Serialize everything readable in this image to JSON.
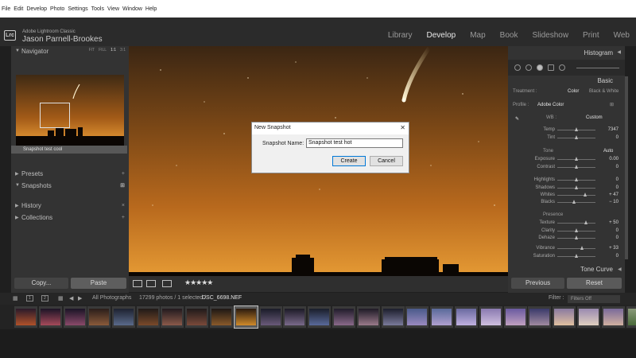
{
  "os_menu": [
    "File",
    "Edit",
    "Develop",
    "Photo",
    "Settings",
    "Tools",
    "View",
    "Window",
    "Help"
  ],
  "identity": {
    "logo": "Lrc",
    "app_name": "Adobe Lightroom Classic",
    "user_name": "Jason Parnell-Brookes"
  },
  "modules": {
    "items": [
      "Library",
      "Develop",
      "Map",
      "Book",
      "Slideshow",
      "Print",
      "Web"
    ],
    "active": "Develop"
  },
  "left_panel": {
    "navigator": {
      "title": "Navigator",
      "zoom_options": [
        "FIT",
        "FILL",
        "1:1",
        "3:1"
      ],
      "zoom_selected": "1:1"
    },
    "presets": {
      "title": "Presets"
    },
    "snapshots": {
      "title": "Snapshots",
      "items": [
        "Snapshot test cool"
      ]
    },
    "history": {
      "title": "History"
    },
    "collections": {
      "title": "Collections"
    },
    "copy_label": "Copy...",
    "paste_label": "Paste"
  },
  "toolbar": {
    "stars": "★★★★★"
  },
  "dialog": {
    "title": "New Snapshot",
    "close": "✕",
    "label": "Snapshot Name:",
    "value": "Snapshot test hot",
    "create_label": "Create",
    "cancel_label": "Cancel"
  },
  "right_panel": {
    "histogram": {
      "title": "Histogram"
    },
    "basic": {
      "title": "Basic",
      "treatment_label": "Treatment :",
      "treatment_color": "Color",
      "treatment_bw": "Black & White",
      "profile_label": "Profile :",
      "profile_value": "Adobe Color",
      "wb_label": "WB :",
      "wb_value": "Custom",
      "tone_label": "Tone",
      "auto_label": "Auto",
      "presence_label": "Presence",
      "sliders": [
        {
          "label": "Temp",
          "value": "7347",
          "pos": 0.5
        },
        {
          "label": "Tint",
          "value": "0",
          "pos": 0.5
        },
        {
          "label": "Exposure",
          "value": "0.00",
          "pos": 0.5
        },
        {
          "label": "Contrast",
          "value": "0",
          "pos": 0.5
        },
        {
          "label": "Highlights",
          "value": "0",
          "pos": 0.5
        },
        {
          "label": "Shadows",
          "value": "0",
          "pos": 0.5
        },
        {
          "label": "Whites",
          "value": "+ 47",
          "pos": 0.73
        },
        {
          "label": "Blacks",
          "value": "− 10",
          "pos": 0.45
        },
        {
          "label": "Texture",
          "value": "+ 50",
          "pos": 0.75
        },
        {
          "label": "Clarity",
          "value": "0",
          "pos": 0.5
        },
        {
          "label": "Dehaze",
          "value": "0",
          "pos": 0.5
        },
        {
          "label": "Vibrance",
          "value": "+ 33",
          "pos": 0.66
        },
        {
          "label": "Saturation",
          "value": "0",
          "pos": 0.5
        }
      ]
    },
    "tone_curve": {
      "title": "Tone Curve"
    },
    "previous_label": "Previous",
    "reset_label": "Reset"
  },
  "filmstrip": {
    "page_1": "1",
    "page_2": "2",
    "source": "All Photographs",
    "count": "17299 photos / 1 selected /",
    "filename": "DSC_6698.NEF",
    "filter_label": "Filter :",
    "filters_value": "Filters Off",
    "thumbnail_count": 26,
    "selected_index": 9
  },
  "colors": {
    "sky_orange": "#c9781f",
    "accent_blue": "#0078d7",
    "panel_bg": "#333333"
  }
}
